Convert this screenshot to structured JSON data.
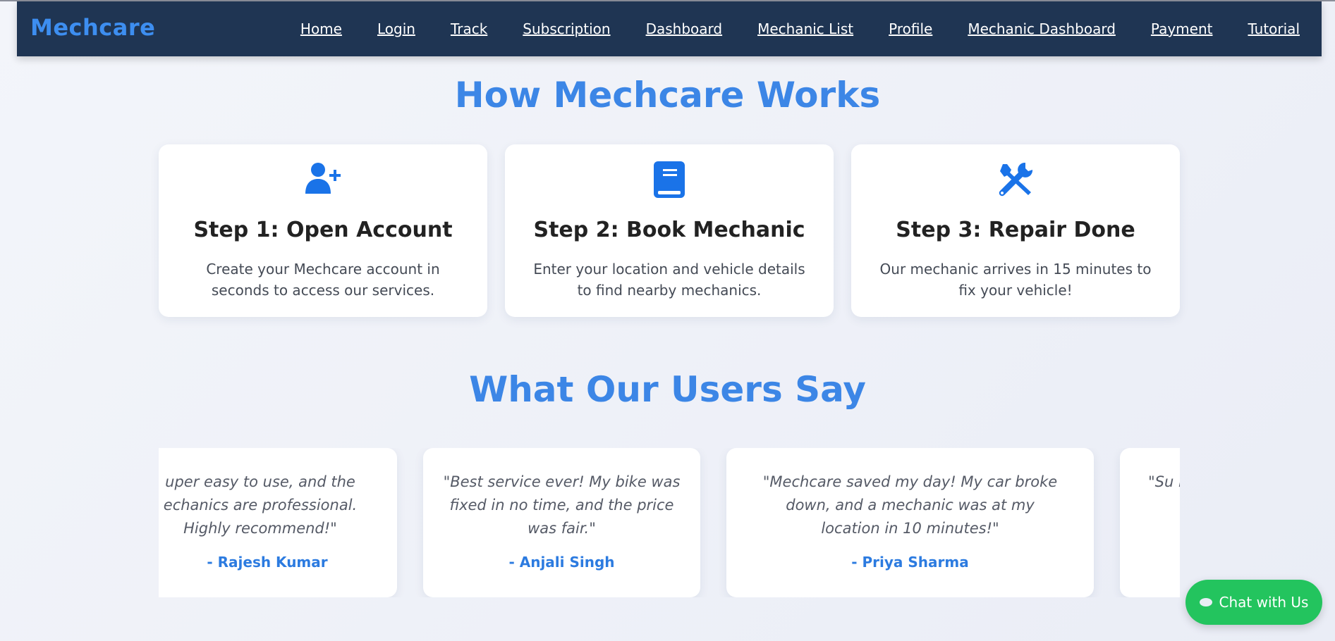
{
  "nav": {
    "brand": "Mechcare",
    "links": [
      "Home",
      "Login",
      "Track",
      "Subscription",
      "Dashboard",
      "Mechanic List",
      "Profile",
      "Mechanic Dashboard",
      "Payment",
      "Tutorial"
    ]
  },
  "how": {
    "title": "How Mechcare Works",
    "steps": [
      {
        "icon": "user-plus-icon",
        "title": "Step 1: Open Account",
        "text": "Create your Mechcare account in seconds to access our services."
      },
      {
        "icon": "book-icon",
        "title": "Step 2: Book Mechanic",
        "text": "Enter your location and vehicle details to find nearby mechanics."
      },
      {
        "icon": "tools-icon",
        "title": "Step 3: Repair Done",
        "text": "Our mechanic arrives in 15 minutes to fix your vehicle!"
      }
    ]
  },
  "testimonials": {
    "title": "What Our Users Say",
    "items": [
      {
        "quote": "uper easy to use, and the echanics are professional. Highly recommend!\"",
        "author": "- Rajesh Kumar"
      },
      {
        "quote": "\"Best service ever! My bike was fixed in no time, and the price was fair.\"",
        "author": "- Anjali Singh"
      },
      {
        "quote": "\"Mechcare saved my day! My car broke down, and a mechanic was at my location in 10 minutes!\"",
        "author": "- Priya Sharma"
      },
      {
        "quote": "\"Su me",
        "author": ""
      }
    ]
  },
  "chat": {
    "label": "Chat with Us"
  },
  "colors": {
    "navbar": "#1f3553",
    "accent": "#3c86e6",
    "chat": "#23c45e"
  }
}
